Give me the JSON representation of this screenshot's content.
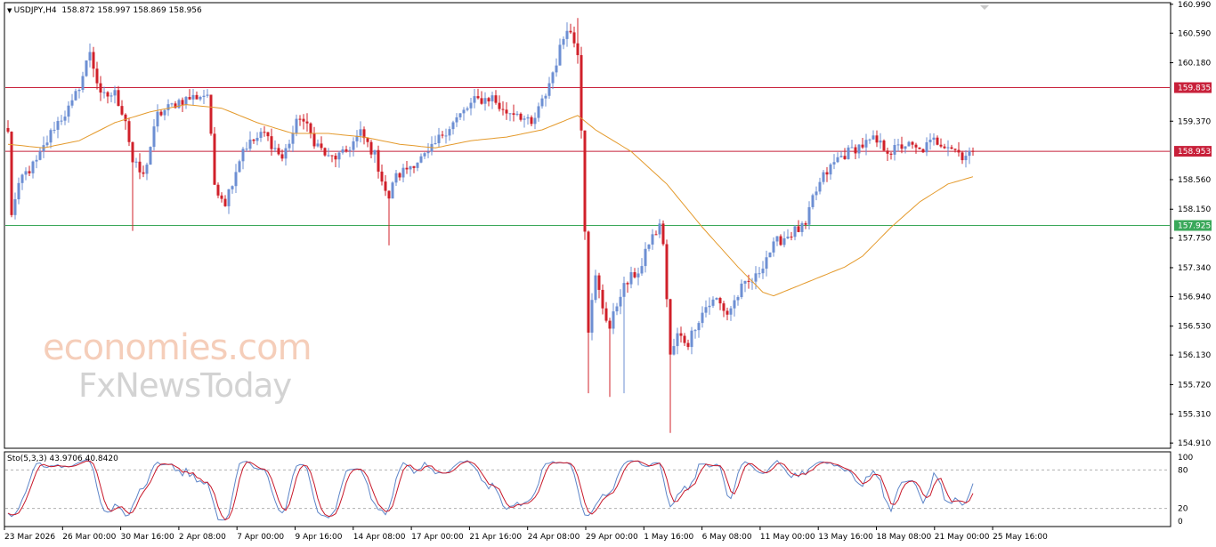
{
  "header": {
    "symbol": "USDJPY,H4",
    "quote": "158.872 158.997 158.869 158.956"
  },
  "oscillator": {
    "label": "Sto(5,3,3) 43.9706 40.8420",
    "ticks": [
      "100",
      "80",
      "20",
      "0"
    ]
  },
  "watermark": {
    "line1": "economies.com",
    "line2": "FxNewsToday"
  },
  "colors": {
    "bull": "#6d8fd3",
    "bear": "#d0202a",
    "ma": "#e49a2c",
    "resistance": "#c8203a",
    "current": "#c8203a",
    "support": "#3aa85a",
    "stoch_main": "#5d85c8",
    "stoch_signal": "#c8182a"
  },
  "chart_data": {
    "type": "candlestick",
    "symbol": "USDJPY",
    "timeframe": "H4",
    "ylim": [
      154.85,
      161.0
    ],
    "y_ticks": [
      "160.990",
      "160.590",
      "160.180",
      "159.370",
      "158.560",
      "158.150",
      "157.750",
      "157.340",
      "156.940",
      "156.530",
      "156.130",
      "155.720",
      "155.310",
      "154.910"
    ],
    "x_ticks": [
      "23 Mar 2026",
      "26 Mar 00:00",
      "30 Mar 16:00",
      "2 Apr 08:00",
      "7 Apr 00:00",
      "9 Apr 16:00",
      "14 Apr 08:00",
      "17 Apr 00:00",
      "21 Apr 16:00",
      "24 Apr 08:00",
      "29 Apr 00:00",
      "1 May 16:00",
      "6 May 08:00",
      "11 May 00:00",
      "13 May 16:00",
      "18 May 08:00",
      "21 May 00:00",
      "25 May 16:00"
    ],
    "horizontal_levels": [
      {
        "label": "159.835",
        "value": 159.835,
        "role": "resistance"
      },
      {
        "label": "158.953",
        "value": 158.953,
        "role": "current"
      },
      {
        "label": "157.925",
        "value": 157.925,
        "role": "support"
      }
    ],
    "close_anchors": [
      [
        0,
        159.2
      ],
      [
        1,
        158.1
      ],
      [
        4,
        158.6
      ],
      [
        8,
        158.8
      ],
      [
        13,
        159.3
      ],
      [
        18,
        159.6
      ],
      [
        21,
        160.0
      ],
      [
        23,
        160.35
      ],
      [
        26,
        159.7
      ],
      [
        30,
        159.75
      ],
      [
        33,
        159.4
      ],
      [
        35,
        158.8
      ],
      [
        38,
        158.6
      ],
      [
        42,
        159.45
      ],
      [
        48,
        159.65
      ],
      [
        52,
        159.7
      ],
      [
        56,
        159.75
      ],
      [
        58,
        158.5
      ],
      [
        61,
        158.25
      ],
      [
        66,
        159.0
      ],
      [
        72,
        159.2
      ],
      [
        77,
        158.85
      ],
      [
        82,
        159.45
      ],
      [
        86,
        159.1
      ],
      [
        90,
        158.85
      ],
      [
        94,
        158.9
      ],
      [
        99,
        159.2
      ],
      [
        103,
        158.9
      ],
      [
        107,
        158.25
      ],
      [
        108,
        158.55
      ],
      [
        114,
        158.8
      ],
      [
        118,
        158.9
      ],
      [
        122,
        159.2
      ],
      [
        127,
        159.45
      ],
      [
        131,
        159.65
      ],
      [
        136,
        159.7
      ],
      [
        139,
        159.5
      ],
      [
        143,
        159.5
      ],
      [
        147,
        159.3
      ],
      [
        151,
        159.75
      ],
      [
        154,
        160.2
      ],
      [
        157,
        160.7
      ],
      [
        160,
        160.35
      ],
      [
        161,
        159.3
      ],
      [
        163,
        156.5
      ],
      [
        165,
        157.2
      ],
      [
        167,
        156.8
      ],
      [
        169,
        156.5
      ],
      [
        172,
        157.0
      ],
      [
        175,
        157.2
      ],
      [
        178,
        157.35
      ],
      [
        180,
        157.7
      ],
      [
        183,
        157.9
      ],
      [
        184,
        157.7
      ],
      [
        186,
        156.1
      ],
      [
        188,
        156.4
      ],
      [
        191,
        156.3
      ],
      [
        193,
        156.55
      ],
      [
        196,
        156.8
      ],
      [
        199,
        156.9
      ],
      [
        202,
        156.7
      ],
      [
        206,
        157.05
      ],
      [
        210,
        157.2
      ],
      [
        213,
        157.5
      ],
      [
        216,
        157.7
      ],
      [
        221,
        157.85
      ],
      [
        224,
        157.9
      ],
      [
        226,
        158.3
      ],
      [
        229,
        158.6
      ],
      [
        233,
        158.85
      ],
      [
        238,
        159.0
      ],
      [
        243,
        159.1
      ],
      [
        248,
        158.95
      ],
      [
        252,
        159.05
      ],
      [
        256,
        158.95
      ],
      [
        260,
        159.1
      ],
      [
        264,
        159.05
      ],
      [
        268,
        158.9
      ],
      [
        271,
        158.956
      ]
    ],
    "spikes": [
      [
        163,
        "low",
        155.6
      ],
      [
        169,
        "low",
        155.55
      ],
      [
        173,
        "low",
        155.6
      ],
      [
        186,
        "low",
        155.05
      ],
      [
        160,
        "high",
        160.8
      ],
      [
        107,
        "low",
        157.65
      ],
      [
        57,
        "high",
        159.65
      ],
      [
        35,
        "low",
        157.85
      ]
    ],
    "ma_anchors": [
      [
        0,
        159.05
      ],
      [
        10,
        159.0
      ],
      [
        20,
        159.1
      ],
      [
        30,
        159.35
      ],
      [
        40,
        159.5
      ],
      [
        50,
        159.6
      ],
      [
        60,
        159.55
      ],
      [
        70,
        159.35
      ],
      [
        80,
        159.2
      ],
      [
        90,
        159.2
      ],
      [
        100,
        159.15
      ],
      [
        110,
        159.05
      ],
      [
        120,
        159.0
      ],
      [
        130,
        159.1
      ],
      [
        140,
        159.15
      ],
      [
        150,
        159.25
      ],
      [
        160,
        159.45
      ],
      [
        165,
        159.25
      ],
      [
        175,
        158.95
      ],
      [
        185,
        158.5
      ],
      [
        195,
        157.9
      ],
      [
        205,
        157.35
      ],
      [
        212,
        157.0
      ],
      [
        215,
        156.95
      ],
      [
        225,
        157.15
      ],
      [
        235,
        157.35
      ],
      [
        240,
        157.5
      ],
      [
        248,
        157.9
      ],
      [
        256,
        158.25
      ],
      [
        264,
        158.5
      ],
      [
        271,
        158.6
      ]
    ],
    "stoch_range": [
      0,
      100
    ],
    "stoch_levels": [
      80,
      20
    ]
  }
}
